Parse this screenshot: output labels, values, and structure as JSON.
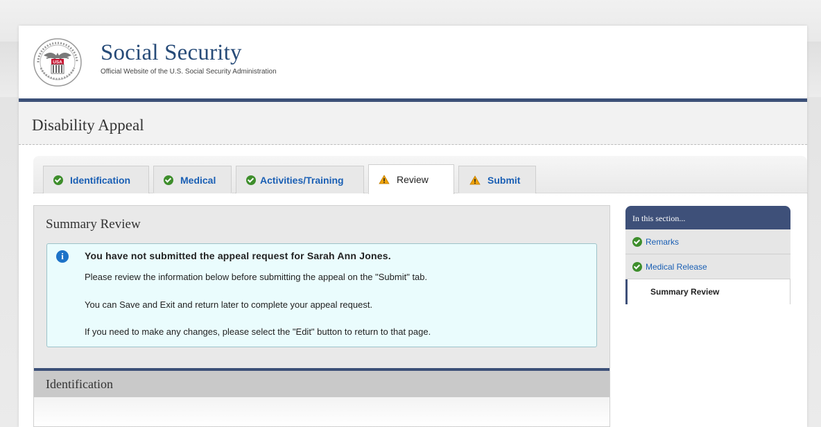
{
  "header": {
    "title": "Social Security",
    "subtitle": "Official Website of the U.S. Social Security Administration",
    "seal_text": "USA"
  },
  "page": {
    "title": "Disability Appeal"
  },
  "tabs": [
    {
      "label": "Identification",
      "status": "complete"
    },
    {
      "label": "Medical",
      "status": "complete"
    },
    {
      "label": "Activities/Training",
      "status": "complete"
    },
    {
      "label": "Review",
      "status": "warning",
      "active": true
    },
    {
      "label": "Submit",
      "status": "warning"
    }
  ],
  "summary": {
    "title": "Summary Review",
    "notice_heading": "You have not submitted the appeal request for Sarah Ann Jones.",
    "lines": [
      "Please review the information below before submitting the appeal on the \"Submit\" tab.",
      "You can Save and Exit and return later to complete your appeal request.",
      "If you need to make any changes, please select the \"Edit\" button to return to that page."
    ]
  },
  "sections": {
    "identification_title": "Identification"
  },
  "sidebar": {
    "heading": "In this section...",
    "items": [
      {
        "label": "Remarks",
        "status": "complete"
      },
      {
        "label": "Medical Release",
        "status": "complete"
      }
    ],
    "current": "Summary Review"
  },
  "colors": {
    "navy": "#3c5078",
    "link": "#1a5fb4",
    "check_green": "#3e8e2c",
    "warning_orange": "#f0a30a",
    "info_bg": "#eafcfd"
  }
}
